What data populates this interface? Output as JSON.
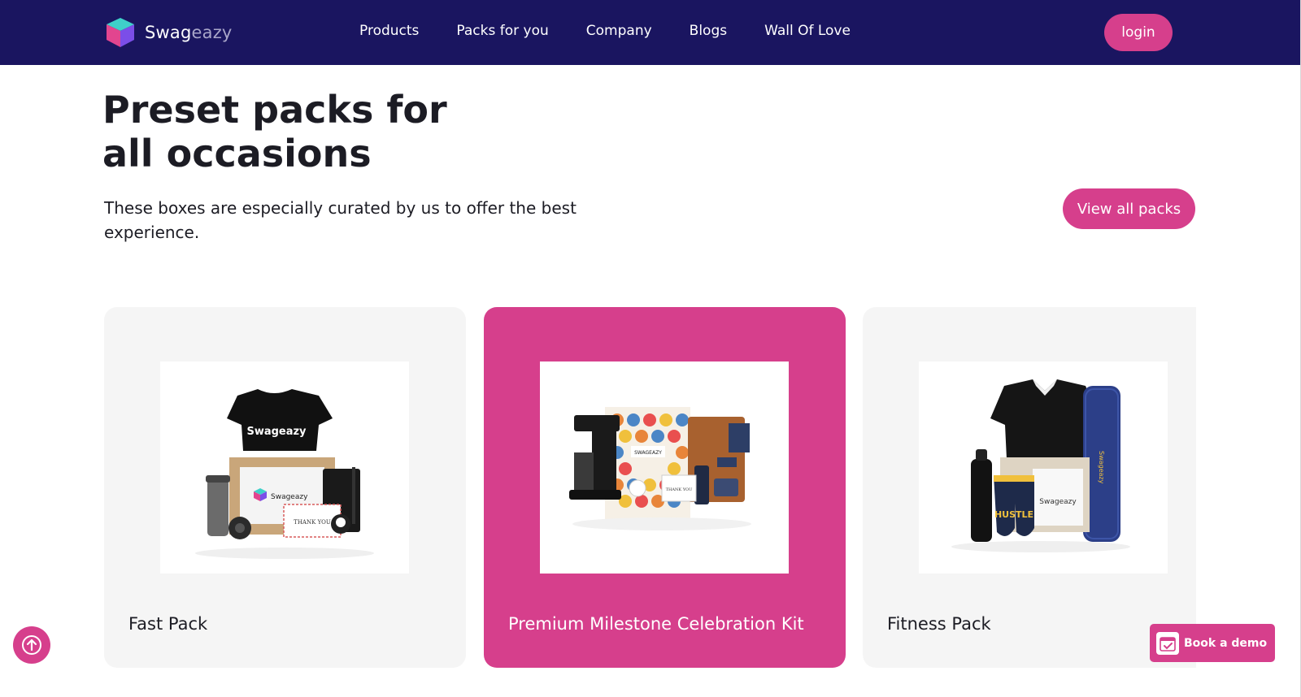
{
  "brand": {
    "name_main": "Swag",
    "name_light": "eazy",
    "colors": {
      "nav_bg": "#1a1560",
      "accent": "#d63f8c"
    }
  },
  "nav": {
    "links": [
      "Products",
      "Packs for you",
      "Company",
      "Blogs",
      "Wall Of Love"
    ],
    "login_label": "login"
  },
  "hero": {
    "title_line1": "Preset packs for",
    "title_line2": "all occasions",
    "subtitle": "These boxes are especially curated by us to offer the best experience.",
    "view_all_label": "View all packs"
  },
  "packs": [
    {
      "label": "Fast Pack",
      "image_icon": "tshirt-swag-kit-icon",
      "active": false,
      "tshirt_text": "Swageazy",
      "box_text": "Swageazy",
      "card_text": "THANK YOU"
    },
    {
      "label": "Premium Milestone Celebration Kit",
      "image_icon": "coffee-maker-kit-icon",
      "active": true,
      "box_text": "SWAGEAZY",
      "card_text": "THANK YOU"
    },
    {
      "label": "Fitness Pack",
      "image_icon": "fitness-kit-icon",
      "active": false,
      "socks_text": "HUSTLE",
      "box_text": "Swageazy",
      "mat_text": "Swageazy"
    }
  ],
  "floating": {
    "scroll_top_icon": "arrow-up-icon",
    "demo_label": "Book a demo",
    "demo_icon": "calendar-check-icon"
  }
}
